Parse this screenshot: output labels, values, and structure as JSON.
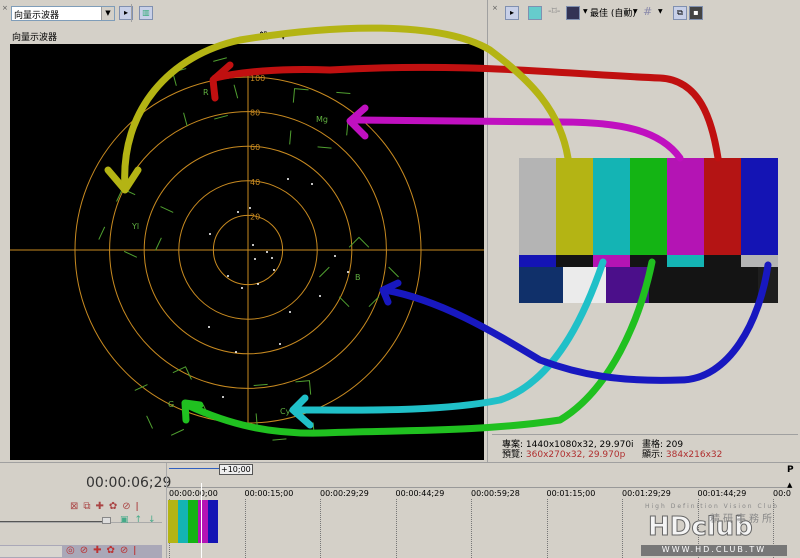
{
  "left_panel": {
    "scope_select": "向量示波器",
    "title": "向量示波器",
    "mode": "一般",
    "scale_labels": [
      "20",
      "40",
      "60",
      "80",
      "100"
    ],
    "targets": [
      {
        "label": "R"
      },
      {
        "label": "Mg"
      },
      {
        "label": "Yl"
      },
      {
        "label": "B"
      },
      {
        "label": "G"
      },
      {
        "label": "Cy"
      }
    ]
  },
  "right_panel": {
    "quality": "最佳 (自動)",
    "project_label": "專案:",
    "project_value": "1440x1080x32, 29.970i",
    "preview_label": "預覽:",
    "preview_value": "360x270x32, 29.970p",
    "frame_label": "畫格:",
    "frame_value": "209",
    "display_label": "顯示:",
    "display_value": "384x216x32",
    "color_bars_top": [
      "#b4b4b4",
      "#b4b414",
      "#14b4b4",
      "#14b414",
      "#b414b4",
      "#b41414",
      "#1414b4"
    ]
  },
  "timeline": {
    "timecode": "00:00:06;29",
    "loop_region": "+10;00",
    "ruler": [
      "00:00:00;00",
      "00:00:15;00",
      "00:00:29;29",
      "00:00:44;29",
      "00:00:59;28",
      "00:01:15;00",
      "00:01:29;29",
      "00:01:44;29",
      "00:0"
    ]
  },
  "watermark": {
    "tagline": "High Definition Vision Club",
    "brand": "HDclub",
    "cn": "精研事務所",
    "url": "WWW.HD.CLUB.TW"
  },
  "annotation_colors": {
    "red": "#c01010",
    "magenta": "#c010c0",
    "yellow": "#b4b414",
    "cyan": "#20c0c8",
    "green": "#20c020",
    "blue": "#1818c0"
  }
}
